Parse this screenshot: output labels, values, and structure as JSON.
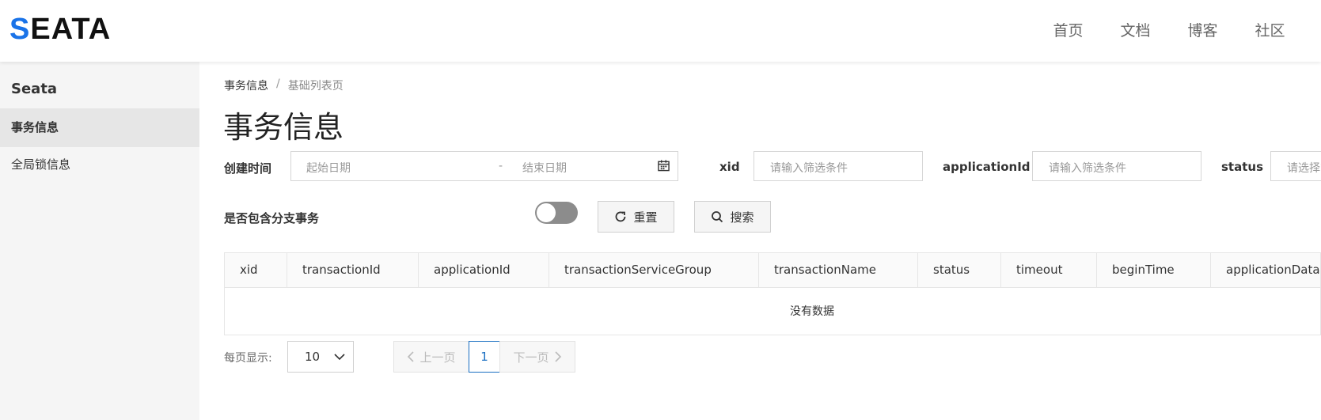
{
  "header": {
    "logo_text": "SEATA",
    "nav": [
      "首页",
      "文档",
      "博客",
      "社区"
    ]
  },
  "sidebar": {
    "title": "Seata",
    "items": [
      {
        "label": "事务信息",
        "active": true
      },
      {
        "label": "全局锁信息",
        "active": false
      }
    ]
  },
  "breadcrumb": {
    "parent": "事务信息",
    "separator": "/",
    "current": "基础列表页"
  },
  "page_title": "事务信息",
  "filters": {
    "create_time_label": "创建时间",
    "start_placeholder": "起始日期",
    "range_separator": "-",
    "end_placeholder": "结束日期",
    "xid_label": "xid",
    "xid_placeholder": "请输入筛选条件",
    "application_label": "applicationId",
    "application_placeholder": "请输入筛选条件",
    "status_label": "status",
    "status_placeholder": "请选择筛选条件",
    "branch_label": "是否包含分支事务",
    "branch_enabled": false
  },
  "buttons": {
    "reset": "重置",
    "search": "搜索"
  },
  "table": {
    "columns": [
      "xid",
      "transactionId",
      "applicationId",
      "transactionServiceGroup",
      "transactionName",
      "status",
      "timeout",
      "beginTime",
      "applicationData"
    ],
    "empty_text": "没有数据"
  },
  "pagination": {
    "page_size_label": "每页显示:",
    "page_size": "10",
    "prev": "上一页",
    "current_page": "1",
    "next": "下一页"
  },
  "colors": {
    "accent": "#1a73e8",
    "pagination_active": "#1a6fc2",
    "sidebar_bg": "#f5f5f5"
  }
}
